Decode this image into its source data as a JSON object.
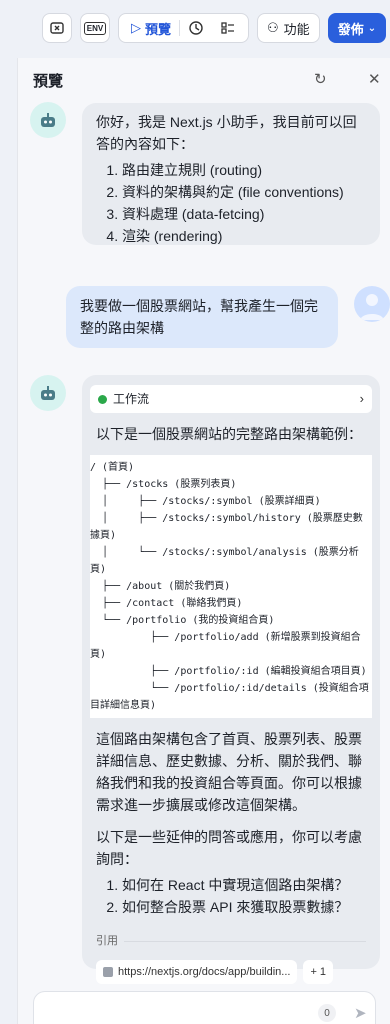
{
  "toolbar": {
    "env_label": "ENV",
    "preview_label": "預覽",
    "features_label": "功能",
    "publish_label": "發佈"
  },
  "panel": {
    "title": "預覽"
  },
  "messages": {
    "bot_intro": {
      "text": "你好，我是 Next.js 小助手，我目前可以回答的內容如下：",
      "items": [
        "路由建立規則 (routing)",
        "資料的架構與約定 (file conventions)",
        "資料處理 (data-fetcing)",
        "渲染 (rendering)"
      ]
    },
    "user_message": "我要做一個股票網站，幫我產生一個完整的路由架構",
    "bot_reply": {
      "workflow_label": "工作流",
      "intro": "以下是一個股票網站的完整路由架構範例：",
      "code": "/ (首頁)\n  ├── /stocks (股票列表頁)\n  │     ├── /stocks/:symbol (股票詳細頁)\n  │     ├── /stocks/:symbol/history (股票歷史數據頁)\n  │     └── /stocks/:symbol/analysis (股票分析頁)\n  ├── /about (關於我們頁)\n  ├── /contact (聯絡我們頁)\n  └── /portfolio (我的投資組合頁)\n          ├── /portfolio/add (新增股票到投資組合頁)\n          ├── /portfolio/:id (編輯投資組合項目頁)\n          └── /portfolio/:id/details (投資組合項目詳細信息頁)",
      "summary": "這個路由架構包含了首頁、股票列表、股票詳細信息、歷史數據、分析、關於我們、聯絡我們和我的投資組合等頁面。你可以根據需求進一步擴展或修改這個架構。",
      "followup_intro": "以下是一些延伸的問答或應用，你可以考慮詢問：",
      "followups": [
        "如何在 React 中實現這個路由架構？",
        "如何整合股票 API 來獲取股票數據？"
      ],
      "references_label": "引用",
      "reference_url": "https://nextjs.org/docs/app/buildin...",
      "more_refs": "+ 1"
    }
  },
  "input": {
    "char_count": "0"
  }
}
